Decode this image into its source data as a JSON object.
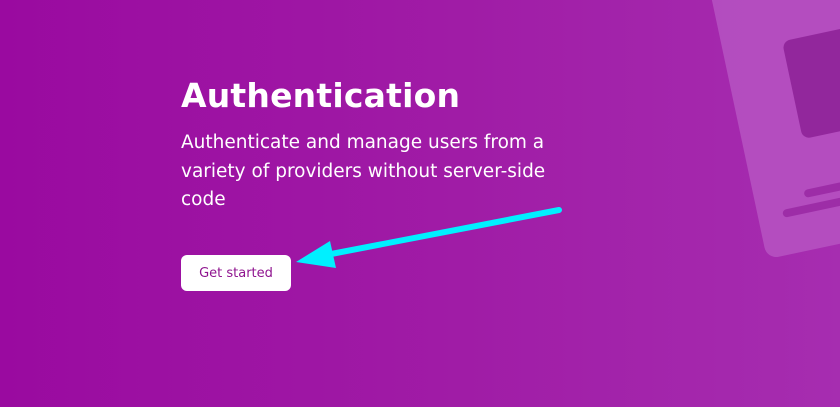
{
  "hero": {
    "title": "Authentication",
    "description": "Authenticate and manage users from a variety of providers without server-side code",
    "cta_label": "Get started"
  },
  "colors": {
    "background": "#9a0aa0",
    "button_text": "#8f148f",
    "annotation_arrow": "#00f0ff"
  }
}
